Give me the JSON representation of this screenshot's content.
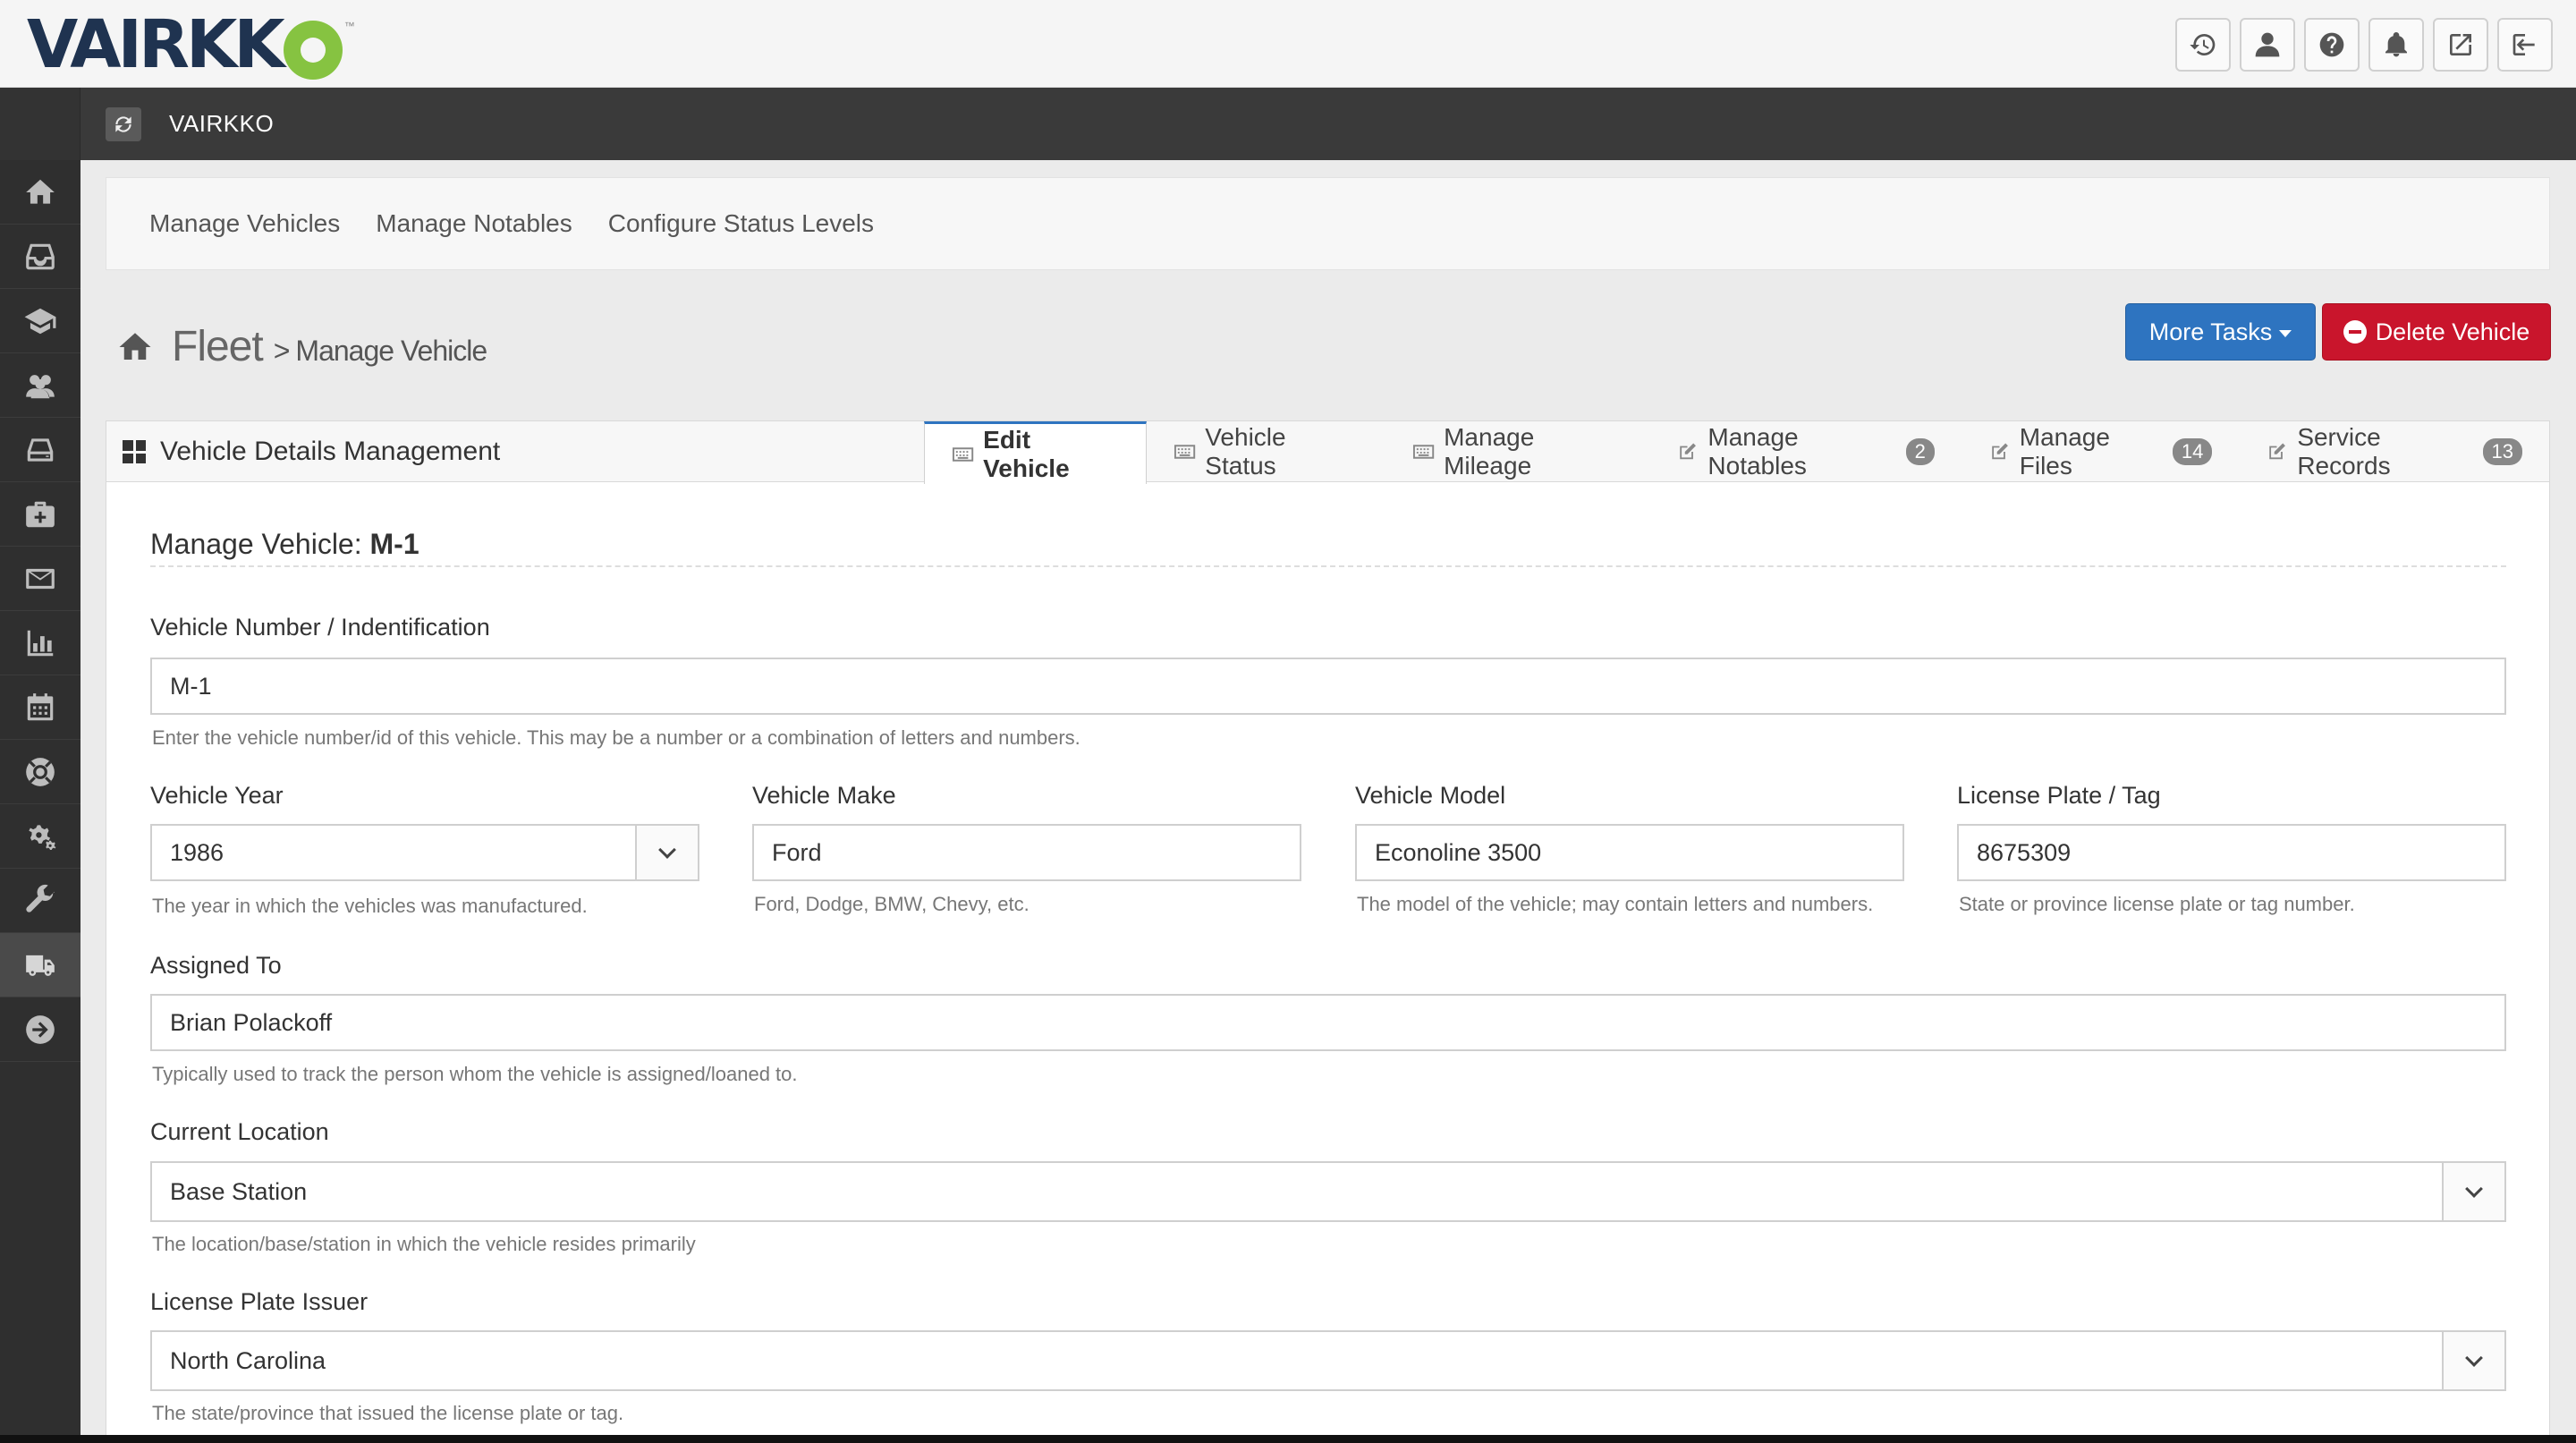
{
  "brand": {
    "logo_text": "VAIRKK",
    "logo_tm": "™"
  },
  "top_icons": [
    {
      "name": "history-icon"
    },
    {
      "name": "user-icon"
    },
    {
      "name": "help-icon"
    },
    {
      "name": "bell-icon"
    },
    {
      "name": "external-link-icon"
    },
    {
      "name": "sign-out-icon"
    }
  ],
  "titlebar": {
    "title": "VAIRKKO"
  },
  "sidebar": {
    "items": [
      {
        "name": "home-icon"
      },
      {
        "name": "inbox-icon"
      },
      {
        "name": "graduation-cap-icon"
      },
      {
        "name": "users-icon"
      },
      {
        "name": "hard-drive-icon"
      },
      {
        "name": "medkit-icon"
      },
      {
        "name": "envelope-icon"
      },
      {
        "name": "bar-chart-icon"
      },
      {
        "name": "calendar-icon"
      },
      {
        "name": "life-ring-icon"
      },
      {
        "name": "cogs-icon"
      },
      {
        "name": "wrench-icon"
      },
      {
        "name": "truck-icon"
      },
      {
        "name": "arrow-circle-right-icon"
      }
    ]
  },
  "subnav": {
    "links": [
      "Manage Vehicles",
      "Manage Notables",
      "Configure Status Levels"
    ]
  },
  "breadcrumb": {
    "main": "Fleet",
    "sep": ">",
    "sub": "Manage Vehicle"
  },
  "actions": {
    "more_tasks": "More Tasks",
    "delete_vehicle": "Delete Vehicle"
  },
  "panel": {
    "title": "Vehicle Details Management",
    "tabs": [
      {
        "label": "Edit Vehicle",
        "badge": ""
      },
      {
        "label": "Vehicle Status",
        "badge": ""
      },
      {
        "label": "Manage Mileage",
        "badge": ""
      },
      {
        "label": "Manage Notables",
        "badge": "2"
      },
      {
        "label": "Manage Files",
        "badge": "14"
      },
      {
        "label": "Service Records",
        "badge": "13"
      }
    ]
  },
  "form": {
    "title_prefix": "Manage Vehicle: ",
    "title_id": "M-1",
    "vehicle_number": {
      "label": "Vehicle Number / Indentification",
      "value": "M-1",
      "help": "Enter the vehicle number/id of this vehicle. This may be a number or a combination of letters and numbers."
    },
    "year": {
      "label": "Vehicle Year",
      "value": "1986",
      "help": "The year in which the vehicles was manufactured."
    },
    "make": {
      "label": "Vehicle Make",
      "value": "Ford",
      "help": "Ford, Dodge, BMW, Chevy, etc."
    },
    "model": {
      "label": "Vehicle Model",
      "value": "Econoline 3500",
      "help": "The model of the vehicle; may contain letters and numbers."
    },
    "plate": {
      "label": "License Plate / Tag",
      "value": "8675309",
      "help": "State or province license plate or tag number."
    },
    "assigned": {
      "label": "Assigned To",
      "value": "Brian Polackoff",
      "help": "Typically used to track the person whom the vehicle is assigned/loaned to."
    },
    "location": {
      "label": "Current Location",
      "value": "Base Station",
      "help": "The location/base/station in which the vehicle resides primarily"
    },
    "issuer": {
      "label": "License Plate Issuer",
      "value": "North Carolina",
      "help": "The state/province that issued the license plate or tag."
    }
  },
  "colors": {
    "primary": "#2e74c0",
    "danger": "#c9152c",
    "dark": "#3a3a3a",
    "brand_navy": "#1f3350",
    "brand_green": "#86c341"
  }
}
